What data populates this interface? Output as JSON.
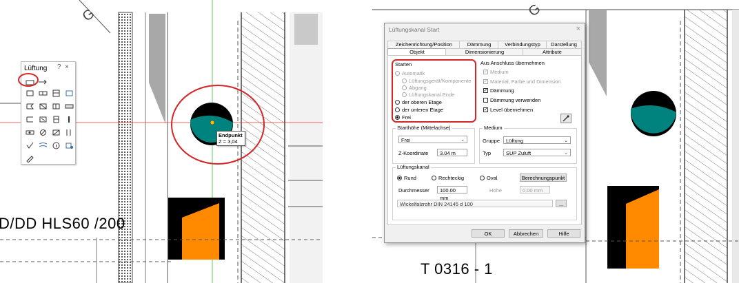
{
  "palette": {
    "title": "Lüftung",
    "help_icon": "?",
    "close_icon": "×",
    "tools": [
      "duct-start-icon",
      "duct-run-icon",
      "component-icon",
      "fitting-icon",
      "valve-icon",
      "damper-icon",
      "grille-icon",
      "outlet-icon",
      "filter-icon",
      "silencer-icon",
      "fan-icon",
      "heater-icon",
      "connector-icon",
      "sensor-icon",
      "coil-icon",
      "flex-icon",
      "check-icon",
      "flow-icon",
      "info-icon",
      "edit-icon",
      "tool-icon",
      "list-icon",
      "report-icon"
    ]
  },
  "left_view": {
    "label_text": "D/DD HLS60 /200",
    "tooltip_title": "Endpunkt",
    "tooltip_value": "Z = 3,04",
    "top_letter": "G"
  },
  "right_view": {
    "label_text": "T 0316 - 1",
    "top_letter": "G"
  },
  "dialog": {
    "title": "Lüftungskanal Start",
    "close_icon": "×",
    "tabs_row1": [
      "Zeichenrichtung/Position",
      "Dämmung",
      "Verbindungstyp",
      "Darstellung"
    ],
    "tabs_row2": [
      "Objekt",
      "Dimensionierung",
      "Attribute"
    ],
    "starten": {
      "title": "Starten",
      "options": [
        "Automatik",
        "Lüftungsgerät/Komponente",
        "Abgang",
        "Lüftungskanal Ende",
        "der oberen Etage",
        "der unteren Etage",
        "Frei"
      ],
      "selected": "Frei"
    },
    "aus_anschluss": {
      "title": "Aus Anschluss übernehmen",
      "items": [
        {
          "label": "Medium",
          "checked": true,
          "enabled": false
        },
        {
          "label": "Material, Farbe und Dimension",
          "checked": true,
          "enabled": false
        },
        {
          "label": "Dämmung",
          "checked": true,
          "enabled": true
        },
        {
          "label": "Dämmung verwenden",
          "checked": false,
          "enabled": true
        },
        {
          "label": "Level übernehmen",
          "checked": true,
          "enabled": true
        }
      ]
    },
    "starthoehe": {
      "title": "Starthöhe (Mittelachse)",
      "mode": "Frei",
      "z_label": "Z-Koordinate",
      "z_value": "3.04 m"
    },
    "medium": {
      "title": "Medium",
      "gruppe_label": "Gruppe",
      "gruppe_value": "Lüftung",
      "typ_label": "Typ",
      "typ_value": "SUP Zuluft"
    },
    "kanal": {
      "title": "Lüftungskanal",
      "shapes": [
        "Rund",
        "Rechteckig",
        "Oval"
      ],
      "selected": "Rund",
      "calc_button": "Berechnungspunkt",
      "durchmesser_label": "Durchmesser",
      "durchmesser_value": "100.00 mm",
      "hoehe_label": "Höhe",
      "hoehe_value": "0.00 mm",
      "material": "Wickelfalzrohr DIN 24145 d 100",
      "browse": "..."
    },
    "buttons": {
      "ok": "OK",
      "cancel": "Abbrechen",
      "help": "Hilfe"
    }
  },
  "colors": {
    "duct_fill": "#00827f",
    "highlight": "#d42626",
    "orange": "#ff8a00",
    "axis_red": "#e53030",
    "axis_green": "#36c136"
  }
}
